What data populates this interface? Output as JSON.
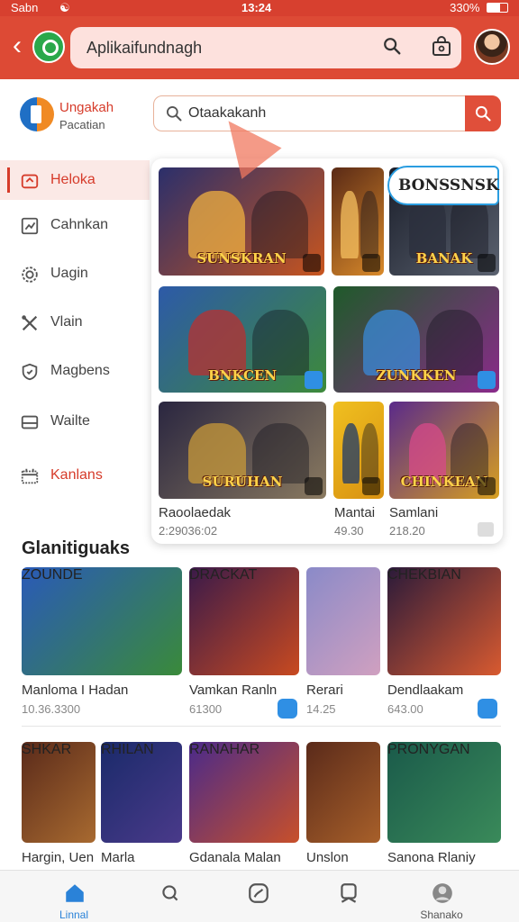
{
  "status_bar": {
    "carrier": "Sabn",
    "time": "13:24",
    "battery": "330%"
  },
  "app_bar": {
    "search_text": "Aplikaifundnagh",
    "back_icon": "back-arrow-icon",
    "search_icon": "search-icon",
    "bag_icon": "shopping-bag-icon"
  },
  "brand": {
    "name": "Ungakah",
    "sub": "Pacatian"
  },
  "search": {
    "value": "Otaakakanh"
  },
  "sidebar": {
    "items": [
      {
        "label": "Heloka",
        "icon": "home-icon"
      },
      {
        "label": "Cahnkan",
        "icon": "chart-icon"
      },
      {
        "label": "Uagin",
        "icon": "gear-icon"
      },
      {
        "label": "Vlain",
        "icon": "tools-icon"
      },
      {
        "label": "Magbens",
        "icon": "shield-icon"
      },
      {
        "label": "Wailte",
        "icon": "bed-icon"
      },
      {
        "label": "Kanlans",
        "icon": "calendar-icon"
      }
    ]
  },
  "featured": {
    "banner": "BONSSNSK",
    "tiles": [
      {
        "art": "SUNSKRAN",
        "colors": [
          "#2b2f6b",
          "#c8551e"
        ],
        "fig": "#f0b040"
      },
      {
        "art": "",
        "colors": [
          "#5a2a16",
          "#d98a2a"
        ],
        "fig": "#f5c060"
      },
      {
        "art": "BANAK",
        "colors": [
          "#1a1e2a",
          "#5b6270"
        ],
        "fig": "#2b2f3c"
      },
      {
        "art": "BNKCEN",
        "colors": [
          "#2d5aa8",
          "#3d8a3a"
        ],
        "fig": "#b83030"
      },
      {
        "art": "ZUNKKEN",
        "colors": [
          "#1f5a2a",
          "#8a2a8a"
        ],
        "fig": "#3a8ad8"
      },
      {
        "art": "SURUHAN",
        "colors": [
          "#2a2640",
          "#8a7a60"
        ],
        "fig": "#c89a3a"
      },
      {
        "art": "",
        "colors": [
          "#f0c020",
          "#d89010"
        ],
        "fig": "#1e3a6a"
      },
      {
        "art": "CHINKEAN",
        "colors": [
          "#5a2a8a",
          "#d8a020"
        ],
        "fig": "#d84a8a"
      }
    ],
    "captions": [
      {
        "name": "Raoolaedak",
        "sub": "2:29036:02"
      },
      {
        "name": "Mantai",
        "sub": "49.30"
      },
      {
        "name": "Samlani",
        "sub": "218.20"
      }
    ]
  },
  "section": {
    "title": "Glanitiguaks",
    "row1": [
      {
        "name": "Manloma I Hadan",
        "price": "10.36.3300",
        "art": "ZOUNDE",
        "colors": [
          "#2a5ab8",
          "#3a8a3a"
        ],
        "fig": "#e09030"
      },
      {
        "name": "Vamkan Ranln",
        "price": "61300",
        "art": "DRACKAT",
        "colors": [
          "#3a1a4a",
          "#c84a20"
        ],
        "fig": "#f0a040"
      },
      {
        "name": "Rerari",
        "price": "14.25",
        "art": "",
        "colors": [
          "#8a8ac8",
          "#d0a0c0"
        ],
        "fig": "#6a3a8a"
      },
      {
        "name": "Dendlaakam",
        "price": "643.00",
        "art": "CHEKBIAN",
        "colors": [
          "#2a1a3a",
          "#d85a30"
        ],
        "fig": "#8a3aa8"
      }
    ],
    "row2": [
      {
        "name": "Hargin, Uen",
        "price": "",
        "art": "SHKAR",
        "colors": [
          "#5a2a1a",
          "#a86a30"
        ],
        "fig": "#d89a4a"
      },
      {
        "name": "Marla",
        "price": "",
        "art": "RHILAN",
        "colors": [
          "#1a2a6a",
          "#4a3a8a"
        ],
        "fig": "#d8a030"
      },
      {
        "name": "Gdanala Malan",
        "price": "",
        "art": "RANAHAR",
        "colors": [
          "#4a2a8a",
          "#c8502a"
        ],
        "fig": "#3a8ad8"
      },
      {
        "name": "Unslon",
        "price": "",
        "art": "",
        "colors": [
          "#5a2a1a",
          "#a8602a"
        ],
        "fig": "#f0b040"
      },
      {
        "name": "Sanona Rlaniy",
        "price": "",
        "art": "PRONYGAN",
        "colors": [
          "#1a5a4a",
          "#3a8a5a"
        ],
        "fig": "#a8d040"
      }
    ]
  },
  "bottom_nav": [
    {
      "label": "Linnal",
      "icon": "home-icon"
    },
    {
      "label": "",
      "icon": "search-icon"
    },
    {
      "label": "",
      "icon": "chat-bubble-icon"
    },
    {
      "label": "",
      "icon": "bookmark-icon"
    },
    {
      "label": "Shanako",
      "icon": "profile-icon"
    }
  ],
  "colors": {
    "accent": "#dd4a35",
    "link": "#2a82d8",
    "badge": "#2f8fe4"
  }
}
